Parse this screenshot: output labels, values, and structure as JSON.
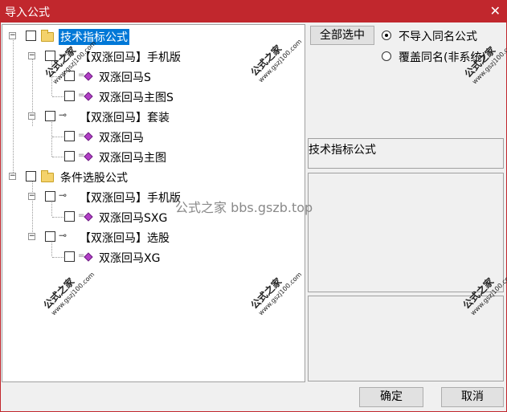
{
  "window": {
    "title": "导入公式",
    "close_glyph": "✕"
  },
  "tree": {
    "nodes": [
      {
        "label": "技术指标公式"
      },
      {
        "label": "【双涨回马】手机版"
      },
      {
        "label": "双涨回马S"
      },
      {
        "label": "双涨回马主图S"
      },
      {
        "label": "【双涨回马】套装"
      },
      {
        "label": "双涨回马"
      },
      {
        "label": "双涨回马主图"
      },
      {
        "label": "条件选股公式"
      },
      {
        "label": "【双涨回马】手机版"
      },
      {
        "label": "双涨回马SXG"
      },
      {
        "label": "【双涨回马】选股"
      },
      {
        "label": "双涨回马XG"
      }
    ],
    "expander_glyph": "−"
  },
  "controls": {
    "select_all": "全部选中",
    "radio_no_import": "不导入同名公式",
    "radio_overwrite": "覆盖同名(非系统)",
    "selected_radio": "no_import"
  },
  "info": {
    "category": "技术指标公式"
  },
  "footer": {
    "ok": "确定",
    "cancel": "取消"
  },
  "watermark": {
    "text": "公式之家",
    "url": "www.gszj100.com",
    "center": "公式之家 bbs.gszb.top"
  },
  "colors": {
    "titlebar": "#c1272d",
    "selection": "#0078d7",
    "gem": "#b23fc6",
    "folder": "#f4d26b"
  }
}
